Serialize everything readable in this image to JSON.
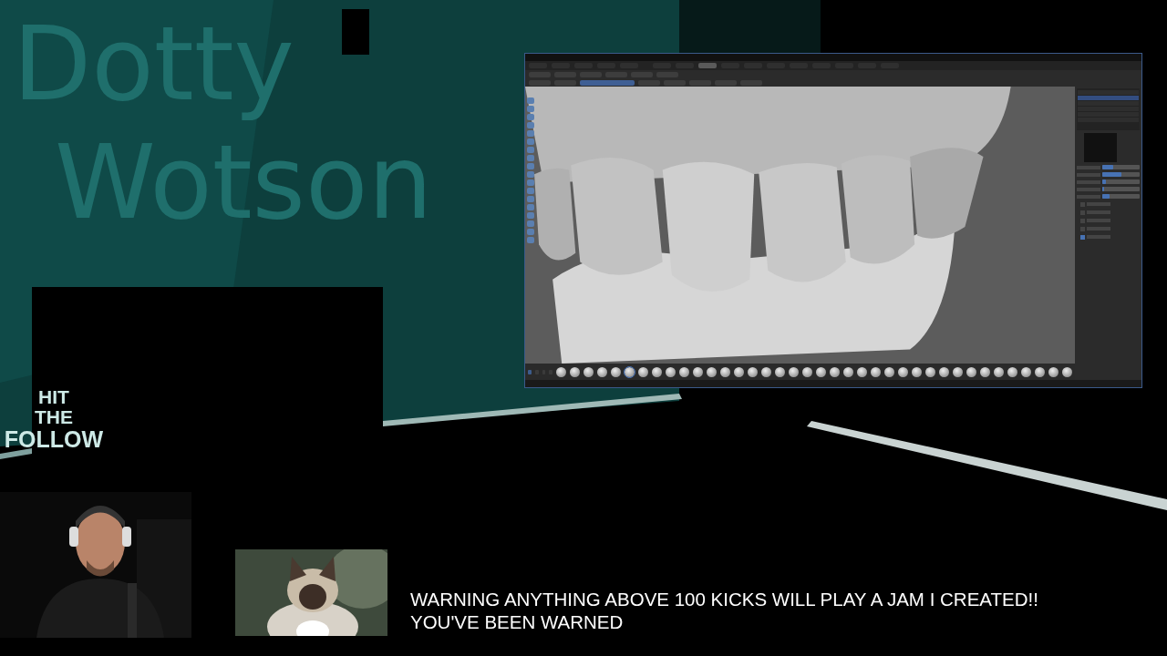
{
  "overlay": {
    "wall_title": [
      "Dotty",
      "Wotson"
    ],
    "follow": [
      "HIT",
      "THE",
      "FOLLOW"
    ],
    "warning": [
      "WARNING ANYTHING ABOVE 100 KICKS WILL PLAY A JAM I CREATED!!",
      "YOU'VE BEEN WARNED"
    ]
  },
  "blender": {
    "workspaces": [
      {
        "selected": false
      },
      {
        "selected": false
      },
      {
        "selected": true
      },
      {
        "selected": false
      },
      {
        "selected": false
      },
      {
        "selected": false
      },
      {
        "selected": false
      },
      {
        "selected": false
      },
      {
        "selected": false
      },
      {
        "selected": false
      },
      {
        "selected": false
      }
    ],
    "properties": {
      "fields": [
        {
          "level": 0.3
        },
        {
          "level": 0.5
        },
        {
          "level": 0.1
        },
        {
          "level": 0.05
        },
        {
          "level": 0.2
        }
      ],
      "sections": [
        {
          "checked": false
        },
        {
          "checked": false
        },
        {
          "checked": false
        },
        {
          "checked": false
        },
        {
          "checked": true
        }
      ]
    },
    "shelf_tabs": [
      {
        "selected": true
      },
      {
        "selected": false
      },
      {
        "selected": false
      },
      {
        "selected": false
      }
    ],
    "brushes": [
      {
        "selected": false
      },
      {
        "selected": false
      },
      {
        "selected": false
      },
      {
        "selected": false
      },
      {
        "selected": false
      },
      {
        "selected": true
      },
      {
        "selected": false
      },
      {
        "selected": false
      },
      {
        "selected": false
      },
      {
        "selected": false
      },
      {
        "selected": false
      },
      {
        "selected": false
      },
      {
        "selected": false
      },
      {
        "selected": false
      },
      {
        "selected": false
      },
      {
        "selected": false
      },
      {
        "selected": false
      },
      {
        "selected": false
      },
      {
        "selected": false
      },
      {
        "selected": false
      },
      {
        "selected": false
      },
      {
        "selected": false
      },
      {
        "selected": false
      },
      {
        "selected": false
      },
      {
        "selected": false
      },
      {
        "selected": false
      },
      {
        "selected": false
      },
      {
        "selected": false
      },
      {
        "selected": false
      },
      {
        "selected": false
      },
      {
        "selected": false
      },
      {
        "selected": false
      },
      {
        "selected": false
      },
      {
        "selected": false
      },
      {
        "selected": false
      },
      {
        "selected": false
      },
      {
        "selected": false
      },
      {
        "selected": false
      }
    ]
  }
}
